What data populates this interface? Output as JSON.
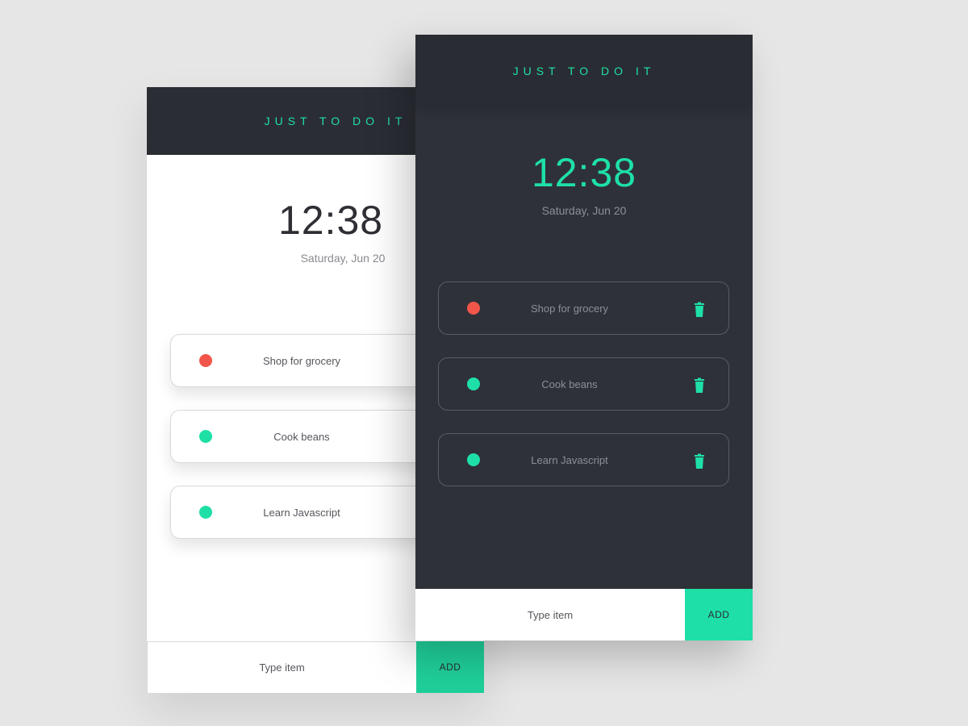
{
  "colors": {
    "background": "#e6e6e7",
    "accent": "#1ee0a6",
    "header_dark": "#2b2d35",
    "panel_dark": "#2f3139",
    "dot_red": "#f2554a",
    "dot_green": "#1ee0a6"
  },
  "light": {
    "header_title": "JUST TO DO IT",
    "clock": "12:38",
    "date": "Saturday, Jun 20",
    "items": [
      {
        "label": "Shop for grocery",
        "status": "red"
      },
      {
        "label": "Cook beans",
        "status": "green"
      },
      {
        "label": "Learn Javascript",
        "status": "green"
      }
    ],
    "input_placeholder": "Type item",
    "add_label": "ADD"
  },
  "dark": {
    "header_title": "JUST TO DO IT",
    "clock": "12:38",
    "date": "Saturday, Jun 20",
    "items": [
      {
        "label": "Shop for grocery",
        "status": "red",
        "icon": "trash-icon"
      },
      {
        "label": "Cook beans",
        "status": "green",
        "icon": "trash-icon"
      },
      {
        "label": "Learn Javascript",
        "status": "green",
        "icon": "trash-icon"
      }
    ],
    "input_placeholder": "Type item",
    "add_label": "ADD"
  }
}
